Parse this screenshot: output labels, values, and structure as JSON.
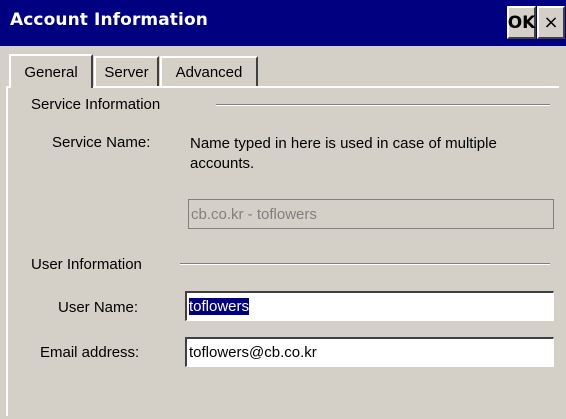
{
  "window": {
    "title": "Account Information",
    "ok_label": "OK",
    "close_label": "×"
  },
  "tabs": [
    {
      "label": "General",
      "selected": true
    },
    {
      "label": "Server",
      "selected": false
    },
    {
      "label": "Advanced",
      "selected": false
    }
  ],
  "service": {
    "heading": "Service Information",
    "name_label": "Service Name:",
    "description": "Name typed in here is used in case of multiple accounts.",
    "name_value": "cb.co.kr - toflowers"
  },
  "user": {
    "heading": "User Information",
    "username_label": "User Name:",
    "username_value": "toflowers",
    "email_label": "Email address:",
    "email_value": "toflowers@cb.co.kr"
  },
  "colors": {
    "titlebar": "#000080",
    "face": "#d4d0c8",
    "selection": "#000080"
  }
}
